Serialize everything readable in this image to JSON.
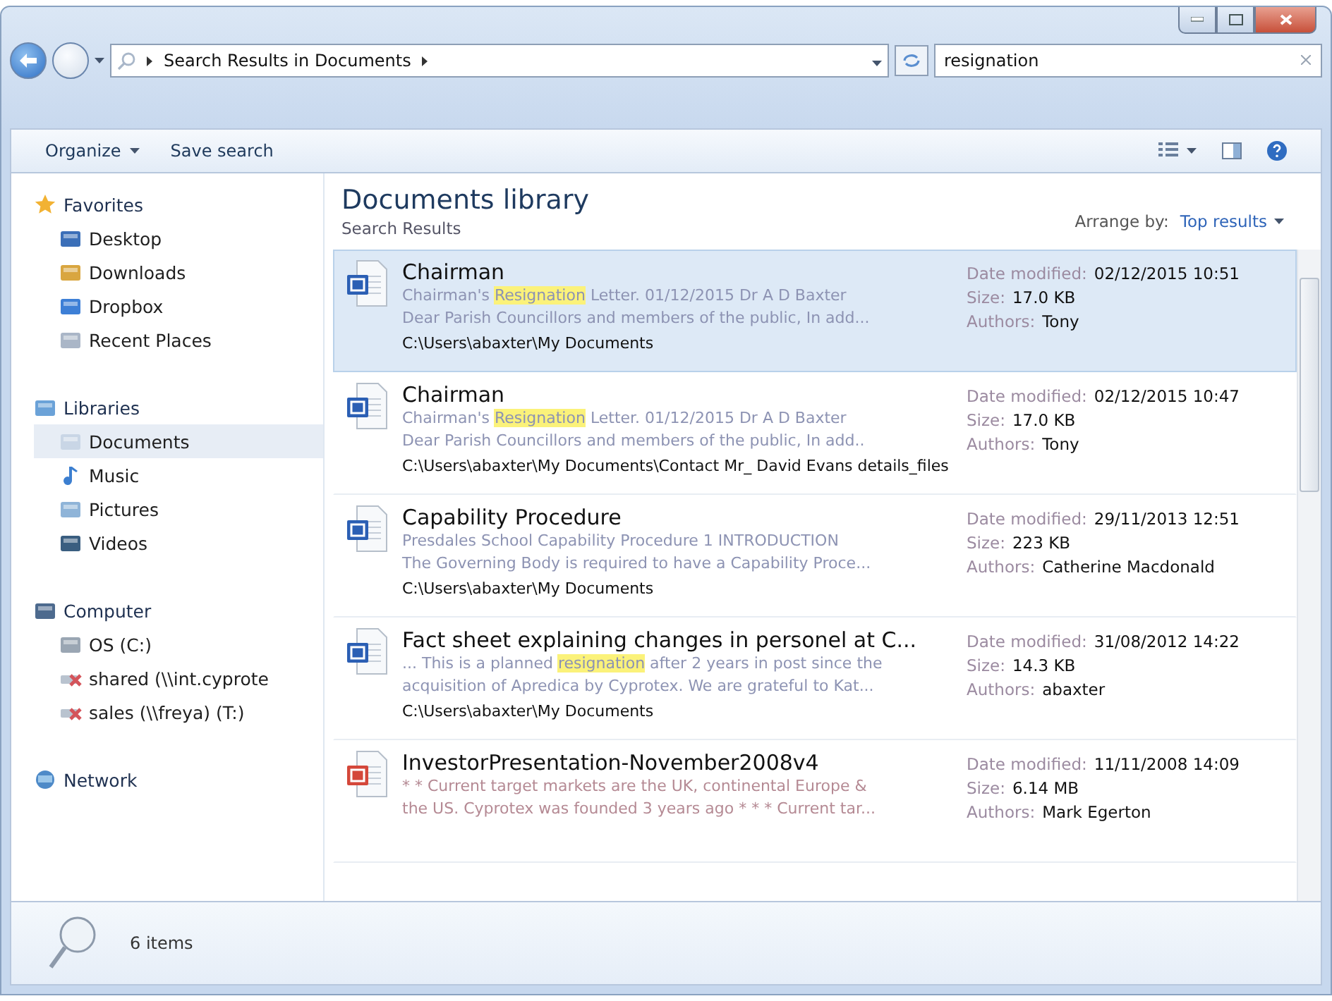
{
  "address_bar": {
    "crumbs": [
      "Search Results in Documents"
    ]
  },
  "search": {
    "value": "resignation"
  },
  "toolbar": {
    "buttons": [
      {
        "label": "Organize",
        "dropdown": true
      },
      {
        "label": "Save search",
        "dropdown": false
      }
    ]
  },
  "nav_pane": [
    {
      "label": "Favorites",
      "kind": "star",
      "selected": false,
      "children": [
        {
          "label": "Desktop",
          "kind": "desktop",
          "selected": false
        },
        {
          "label": "Downloads",
          "kind": "downloads",
          "selected": false
        },
        {
          "label": "Dropbox",
          "kind": "dropbox",
          "selected": false
        },
        {
          "label": "Recent Places",
          "kind": "recent",
          "selected": false
        }
      ]
    },
    {
      "label": "Libraries",
      "kind": "library",
      "selected": false,
      "children": [
        {
          "label": "Documents",
          "kind": "documents",
          "selected": true
        },
        {
          "label": "Music",
          "kind": "music",
          "selected": false
        },
        {
          "label": "Pictures",
          "kind": "pictures",
          "selected": false
        },
        {
          "label": "Videos",
          "kind": "videos",
          "selected": false
        }
      ]
    },
    {
      "label": "Computer",
      "kind": "computer",
      "selected": false,
      "children": [
        {
          "label": "OS (C:)",
          "kind": "drive",
          "selected": false
        },
        {
          "label": "shared (\\\\int.cyprote",
          "kind": "netdrive",
          "selected": false
        },
        {
          "label": "sales (\\\\freya) (T:)",
          "kind": "netdrive",
          "selected": false
        }
      ]
    },
    {
      "label": "Network",
      "kind": "network",
      "selected": false
    }
  ],
  "library": {
    "title": "Documents library",
    "subtitle": "Search Results",
    "arrange_label": "Arrange by:",
    "arrange_value": "Top results"
  },
  "results": [
    {
      "kind": "word",
      "selected": true,
      "title": "Chairman",
      "snippet": [
        [
          {
            "text": "Chairman's ",
            "highlight": false
          },
          {
            "text": "Resignation",
            "highlight": true
          },
          {
            "text": " Letter. 01/12/2015 Dr A D Baxter",
            "highlight": false
          }
        ],
        [
          {
            "text": "Dear Parish Councillors and members of the public, In add...",
            "highlight": false
          }
        ]
      ],
      "path": "C:\\Users\\abaxter\\My Documents",
      "details": [
        {
          "label": "Date modified:",
          "value": "02/12/2015 10:51"
        },
        {
          "label": "Size:",
          "value": "17.0 KB"
        },
        {
          "label": "Authors:",
          "value": "Tony"
        }
      ]
    },
    {
      "kind": "word",
      "selected": false,
      "title": "Chairman",
      "snippet": [
        [
          {
            "text": "Chairman's ",
            "highlight": false
          },
          {
            "text": "Resignation",
            "highlight": true
          },
          {
            "text": " Letter. 01/12/2015 Dr A D Baxter",
            "highlight": false
          }
        ],
        [
          {
            "text": "Dear Parish Councillors and members of the public, In add..",
            "highlight": false
          }
        ]
      ],
      "path": "C:\\Users\\abaxter\\My Documents\\Contact Mr_ David Evans details_files",
      "details": [
        {
          "label": "Date modified:",
          "value": "02/12/2015 10:47"
        },
        {
          "label": "Size:",
          "value": "17.0 KB"
        },
        {
          "label": "Authors:",
          "value": "Tony"
        }
      ]
    },
    {
      "kind": "word",
      "selected": false,
      "title": "Capability Procedure",
      "snippet": [
        [
          {
            "text": "Presdales School Capability Procedure 1 INTRODUCTION",
            "highlight": false
          }
        ],
        [
          {
            "text": "The Governing Body is required to have a Capability Proce...",
            "highlight": false
          }
        ]
      ],
      "path": "C:\\Users\\abaxter\\My Documents",
      "details": [
        {
          "label": "Date modified:",
          "value": "29/11/2013 12:51"
        },
        {
          "label": "Size:",
          "value": "223 KB"
        },
        {
          "label": "Authors:",
          "value": "Catherine Macdonald"
        }
      ]
    },
    {
      "kind": "word",
      "selected": false,
      "title": "Fact sheet explaining changes in personel at C...",
      "snippet": [
        [
          {
            "text": "... This is a planned ",
            "highlight": false
          },
          {
            "text": "resignation",
            "highlight": true
          },
          {
            "text": " after 2 years in post since the",
            "highlight": false
          }
        ],
        [
          {
            "text": "acquisition of Apredica by Cyprotex. We are grateful to Kat...",
            "highlight": false
          }
        ]
      ],
      "path": "C:\\Users\\abaxter\\My Documents",
      "details": [
        {
          "label": "Date modified:",
          "value": "31/08/2012 14:22"
        },
        {
          "label": "Size:",
          "value": "14.3 KB"
        },
        {
          "label": "Authors:",
          "value": "abaxter"
        }
      ]
    },
    {
      "kind": "powerpoint",
      "selected": false,
      "title": "InvestorPresentation-November2008v4",
      "snippet": [
        [
          {
            "text": "* * Current target markets are the UK, continental Europe &",
            "highlight": false
          }
        ],
        [
          {
            "text": "the US. Cyprotex was founded 3 years ago * * * Current tar...",
            "highlight": false
          }
        ]
      ],
      "details": [
        {
          "label": "Date modified:",
          "value": "11/11/2008 14:09"
        },
        {
          "label": "Size:",
          "value": "6.14 MB"
        },
        {
          "label": "Authors:",
          "value": "Mark Egerton"
        }
      ]
    }
  ],
  "status_bar": {
    "count": "6 items"
  }
}
